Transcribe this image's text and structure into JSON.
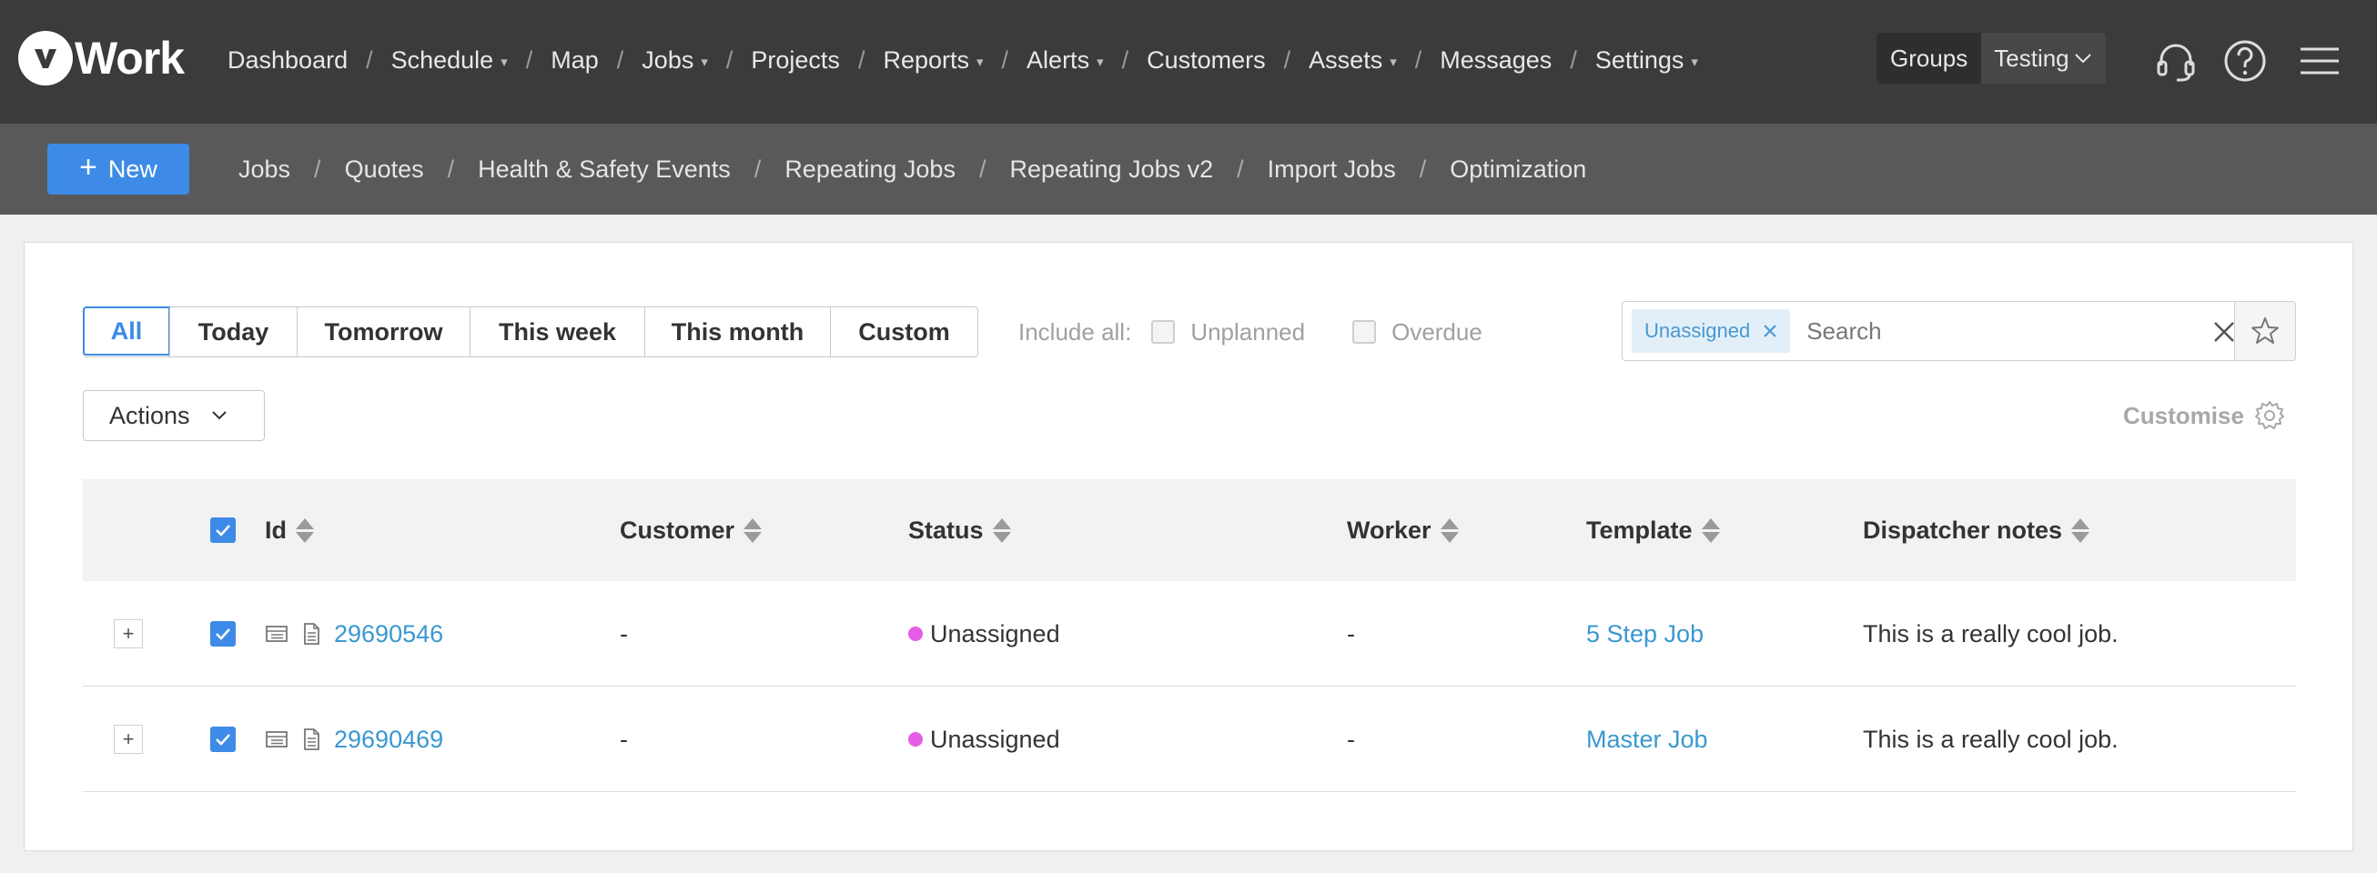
{
  "app": {
    "logo_text": "Work",
    "logo_letter": "v"
  },
  "topnav": {
    "items": [
      {
        "label": "Dashboard",
        "dropdown": false
      },
      {
        "label": "Schedule",
        "dropdown": true
      },
      {
        "label": "Map",
        "dropdown": false
      },
      {
        "label": "Jobs",
        "dropdown": true
      },
      {
        "label": "Projects",
        "dropdown": false
      },
      {
        "label": "Reports",
        "dropdown": true
      },
      {
        "label": "Alerts",
        "dropdown": true
      },
      {
        "label": "Customers",
        "dropdown": false
      },
      {
        "label": "Assets",
        "dropdown": true
      },
      {
        "label": "Messages",
        "dropdown": false
      },
      {
        "label": "Settings",
        "dropdown": true
      }
    ],
    "groups_label": "Groups",
    "group_selected": "Testing",
    "icons": [
      "headset-icon",
      "help-icon",
      "menu-icon"
    ]
  },
  "subnav": {
    "new_label": "New",
    "items": [
      "Jobs",
      "Quotes",
      "Health & Safety Events",
      "Repeating Jobs",
      "Repeating Jobs v2",
      "Import Jobs",
      "Optimization"
    ]
  },
  "filters": {
    "periods": [
      "All",
      "Today",
      "Tomorrow",
      "This week",
      "This month",
      "Custom"
    ],
    "active_period": "All",
    "include_all_label": "Include all:",
    "unplanned_label": "Unplanned",
    "overdue_label": "Overdue",
    "chip_label": "Unassigned",
    "search_placeholder": "Search",
    "actions_label": "Actions",
    "customise_label": "Customise"
  },
  "table": {
    "columns": [
      "Id",
      "Customer",
      "Status",
      "Worker",
      "Template",
      "Dispatcher notes"
    ],
    "rows": [
      {
        "id": "29690546",
        "customer": "-",
        "status": "Unassigned",
        "worker": "-",
        "template": "5 Step Job",
        "notes": "This is a really cool job."
      },
      {
        "id": "29690469",
        "customer": "-",
        "status": "Unassigned",
        "worker": "-",
        "template": "Master Job",
        "notes": "This is a really cool job."
      }
    ]
  },
  "colors": {
    "topbar": "#3b3b3b",
    "subbar": "#595959",
    "accent": "#3d8be6",
    "link": "#3a98d0",
    "status_unassigned": "#e55ce5"
  }
}
